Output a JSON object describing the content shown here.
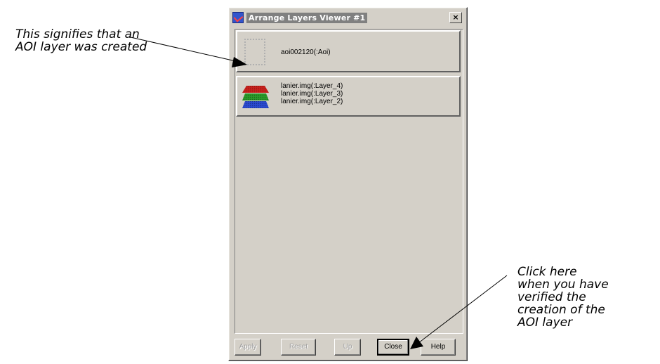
{
  "annotations": {
    "aoi_note": "This signifies that an\nAOI layer was created",
    "close_note": "Click here\nwhen you have\nverified the\ncreation of the\nAOI layer"
  },
  "window": {
    "title": "Arrange Layers Viewer #1",
    "close_glyph": "×"
  },
  "layers": {
    "aoi": {
      "label": "aoi002120(:Aoi)",
      "icon": "aoi-layer-icon"
    },
    "raster": {
      "icon": "raster-layers-icon",
      "lines": [
        "lanier.img(:Layer_4)",
        "lanier.img(:Layer_3)",
        "lanier.img(:Layer_2)"
      ]
    }
  },
  "buttons": {
    "apply": "Apply",
    "reset": "Reset",
    "up": "Up",
    "close": "Close",
    "help": "Help"
  },
  "colors": {
    "window_bg": "#d4d0c8",
    "layer_red": "#c8201c",
    "layer_green": "#2a9a2a",
    "layer_blue": "#2a4ad0"
  }
}
